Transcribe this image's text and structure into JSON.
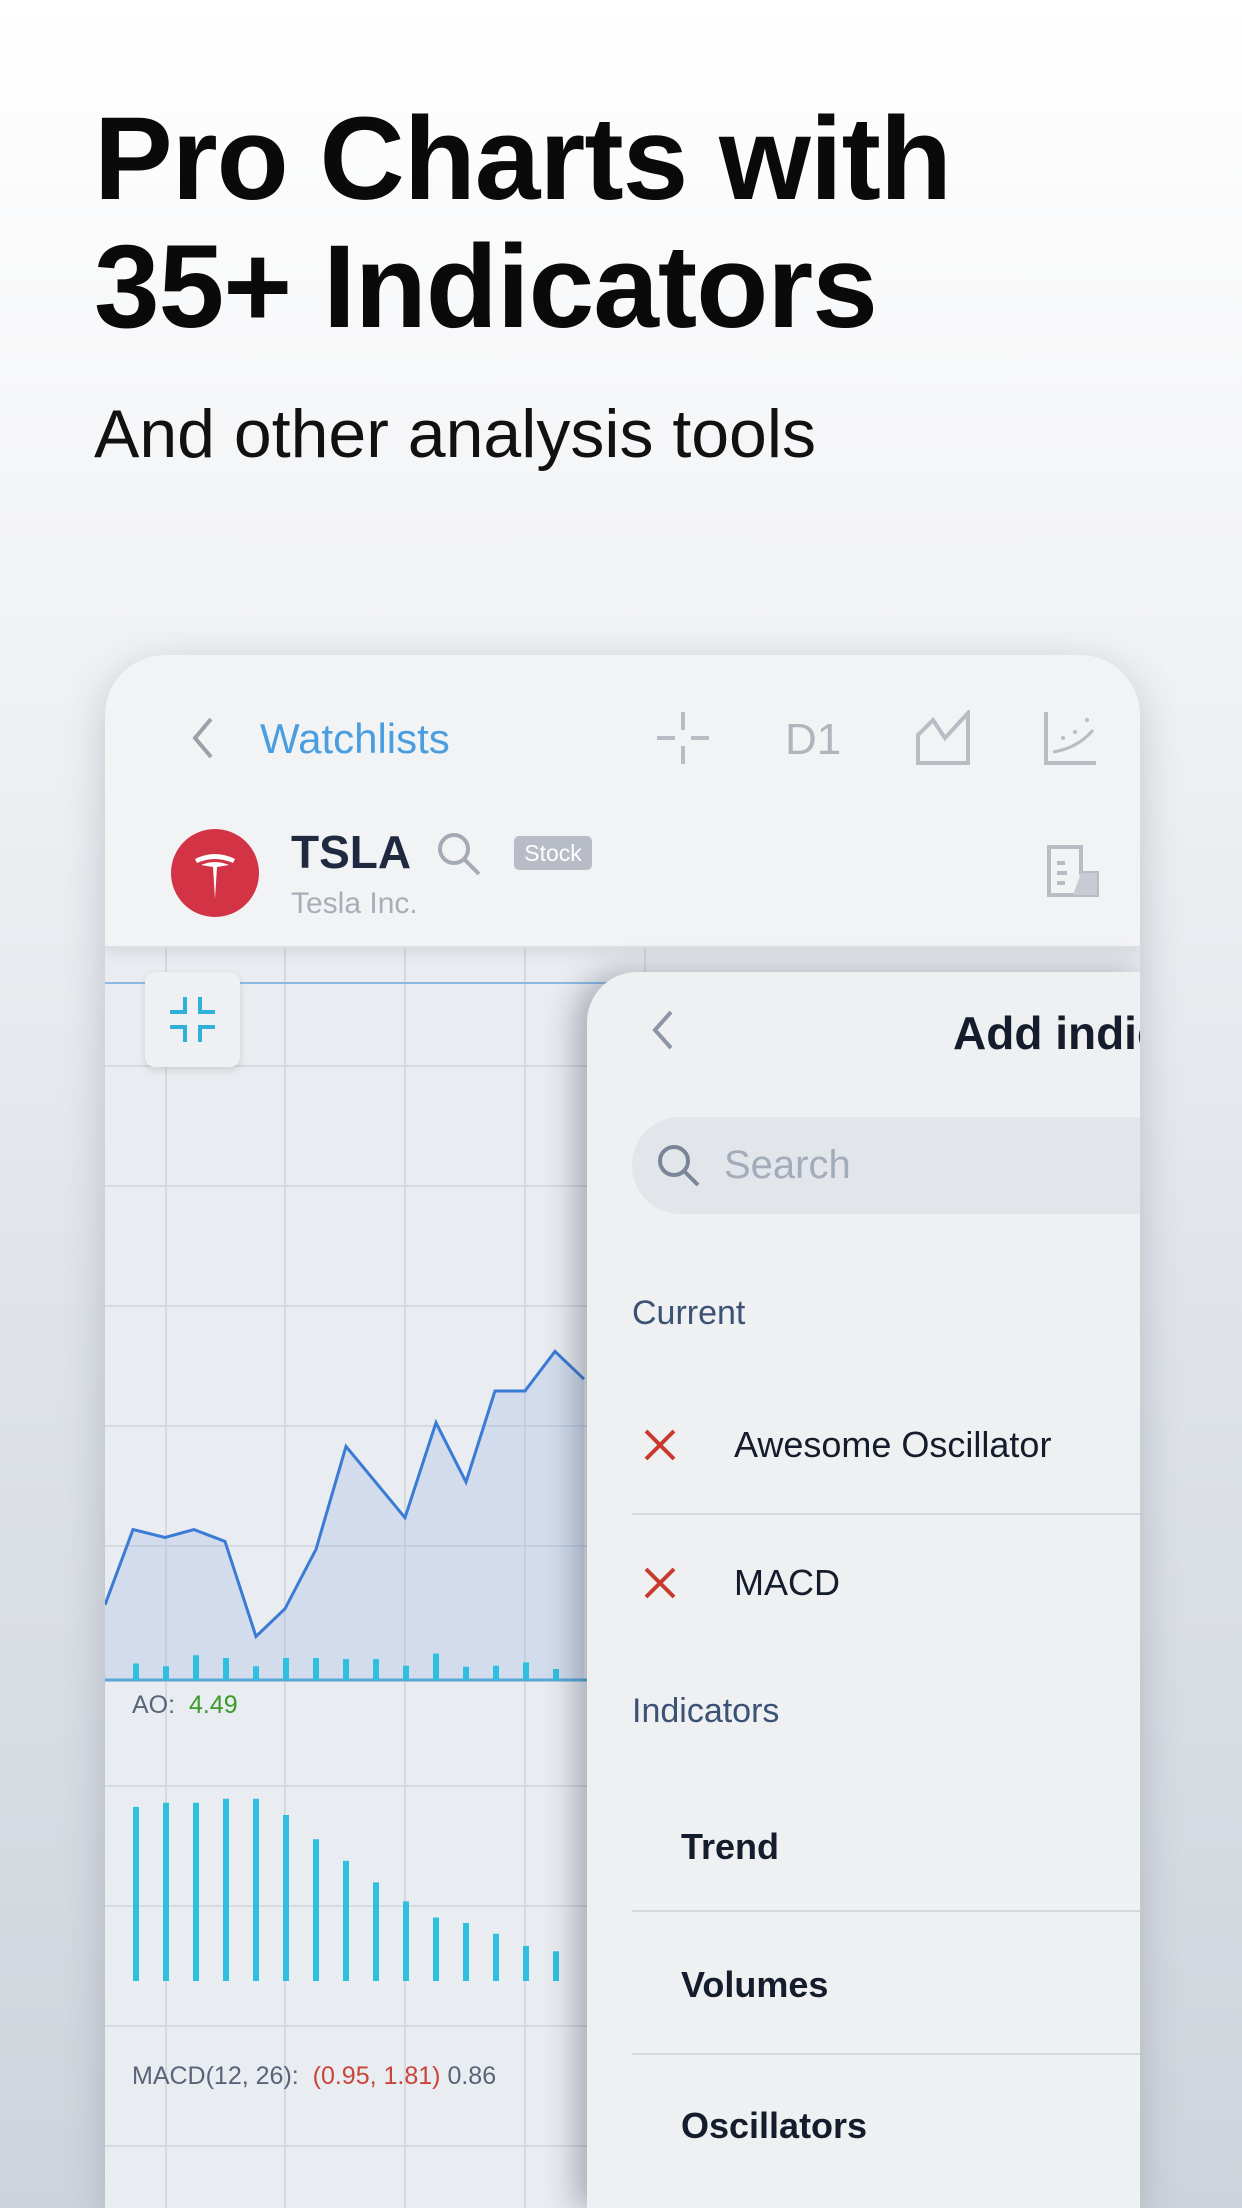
{
  "promo": {
    "title_line1": "Pro Charts with",
    "title_line2": "35+ Indicators",
    "subtitle": "And other analysis tools"
  },
  "header": {
    "back_label": "Watchlists",
    "timeframe": "D1",
    "icons": [
      "chevron-left-icon",
      "crosshair-icon",
      "chart-type-icon",
      "indicators-icon",
      "document-icon"
    ],
    "symbol": "TSLA",
    "badge": "Stock",
    "company": "Tesla Inc.",
    "logo_color": "#d23446",
    "accent": "#4a9ee0"
  },
  "chart": {
    "ao_label": "AO:",
    "ao_value": "4.49",
    "macd_label": "MACD(12, 26):",
    "macd_values": "(0.95, 1.81)",
    "macd_hist": "0.86",
    "colors": {
      "line": "#3a7bd5",
      "bars": "#2ec0de",
      "ao_value": "#3a9a2a",
      "macd_red": "#c9453a"
    }
  },
  "chart_data": {
    "type": "line",
    "price_series": [
      40,
      78,
      74,
      78,
      72,
      24,
      38,
      68,
      120,
      84,
      132,
      102,
      148,
      148,
      168,
      154
    ],
    "ao_bars": [
      3,
      2.5,
      4.5,
      4,
      2.5,
      4,
      4,
      3.8,
      3.8,
      2.6,
      4.8,
      2.4,
      2.6,
      3.2,
      2
    ],
    "macd_bars": [
      129,
      132,
      132,
      135,
      135,
      123,
      105,
      89,
      73,
      59,
      47,
      43,
      35,
      26,
      22
    ]
  },
  "panel": {
    "title": "Add indic",
    "search_placeholder": "Search",
    "current_heading": "Current",
    "current": [
      "Awesome Oscillator",
      "MACD"
    ],
    "indicators_heading": "Indicators",
    "categories": [
      "Trend",
      "Volumes",
      "Oscillators"
    ]
  }
}
